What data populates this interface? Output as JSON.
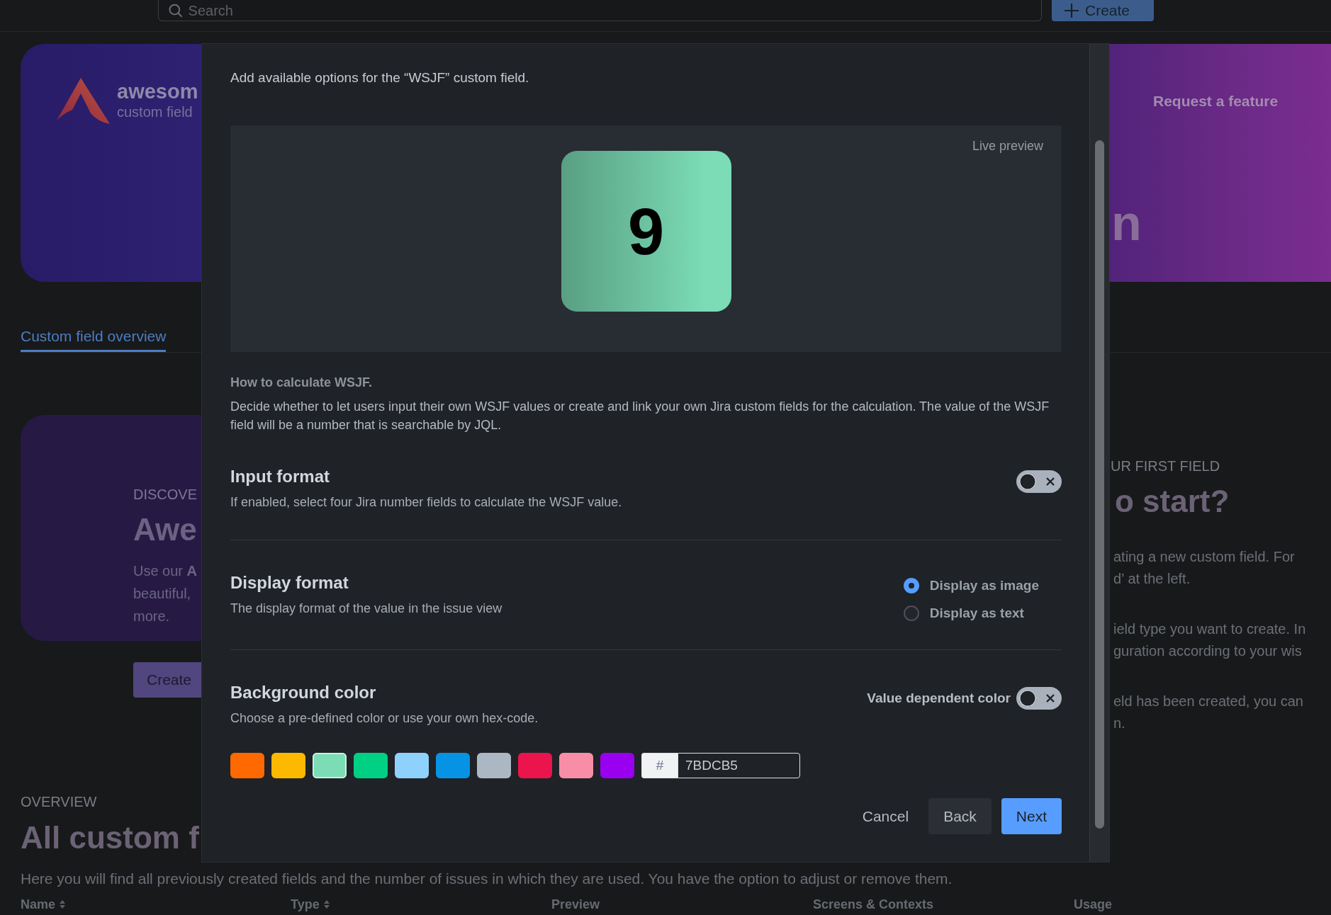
{
  "top_bar": {
    "search": {
      "placeholder": "Search"
    },
    "create_button": "Create"
  },
  "banner": {
    "logo_title": "awesom",
    "logo_subtitle": "custom field",
    "link": "Request a feature",
    "heading_fragment": "n"
  },
  "tabs": [
    {
      "label": "Custom field overview",
      "selected": true
    }
  ],
  "discover_card": {
    "eyebrow": "DISCOVE",
    "title": "Awe",
    "lines": [
      "Use our **A**",
      "beautiful,",
      "more."
    ],
    "button": "Create"
  },
  "first_field": {
    "eyebrow": "UR FIRST FIELD",
    "title": "o start?",
    "paragraphs": [
      [
        "ating a new custom field. For",
        "d’ at the left."
      ],
      [
        "ield type you want to create. In",
        "guration according to your wis"
      ],
      [
        "eld has been created, you can",
        "n."
      ]
    ]
  },
  "overview": {
    "eyebrow": "OVERVIEW",
    "title": "All custom f",
    "description": "Here you will find all previously created fields and the number of issues in which they are used. You have the option to adjust or remove them.",
    "columns": [
      {
        "label": "Name",
        "sortable": true
      },
      {
        "label": "Type",
        "sortable": true
      },
      {
        "label": "Preview",
        "sortable": false
      },
      {
        "label": "Screens & Contexts",
        "sortable": false
      },
      {
        "label": "Usage",
        "sortable": false
      }
    ]
  },
  "dialog": {
    "intro": "Add available options for the “WSJF” custom field.",
    "preview": {
      "label": "Live preview",
      "value": "9"
    },
    "calculation": {
      "title": "How to calculate WSJF.",
      "text": "Decide whether to let users input their own WSJF values or create and link your own Jira custom fields for the calculation. The value of the WSJF field will be a number that is searchable by JQL."
    },
    "sections": [
      {
        "kind": "toggle",
        "title": "Input format",
        "description": "If enabled, select four Jira number fields to calculate the WSJF value.",
        "on": false
      },
      {
        "kind": "radio",
        "title": "Display format",
        "description": "The display format of the value in the issue view",
        "options": [
          {
            "label": "Display as image",
            "selected": true
          },
          {
            "label": "Display as text",
            "selected": false
          }
        ]
      },
      {
        "kind": "color",
        "title": "Background color",
        "description": "Choose a pre-defined color or use your own hex-code.",
        "toggle": {
          "label": "Value dependent color",
          "on": false
        },
        "swatches": [
          {
            "color": "#ff6900",
            "selected": false
          },
          {
            "color": "#fcb900",
            "selected": false
          },
          {
            "color": "#7bdcb5",
            "selected": true
          },
          {
            "color": "#00d084",
            "selected": false
          },
          {
            "color": "#8ed1fc",
            "selected": false
          },
          {
            "color": "#0693e3",
            "selected": false
          },
          {
            "color": "#abb8c3",
            "selected": false
          },
          {
            "color": "#eb144c",
            "selected": false
          },
          {
            "color": "#f78da7",
            "selected": false
          },
          {
            "color": "#9900ef",
            "selected": false
          }
        ],
        "hex": {
          "prefix": "#",
          "value": "7BDCB5"
        }
      }
    ],
    "buttons": [
      {
        "kind": "subtle",
        "label": "Cancel"
      },
      {
        "kind": "default",
        "label": "Back"
      },
      {
        "kind": "primary",
        "label": "Next"
      }
    ]
  }
}
